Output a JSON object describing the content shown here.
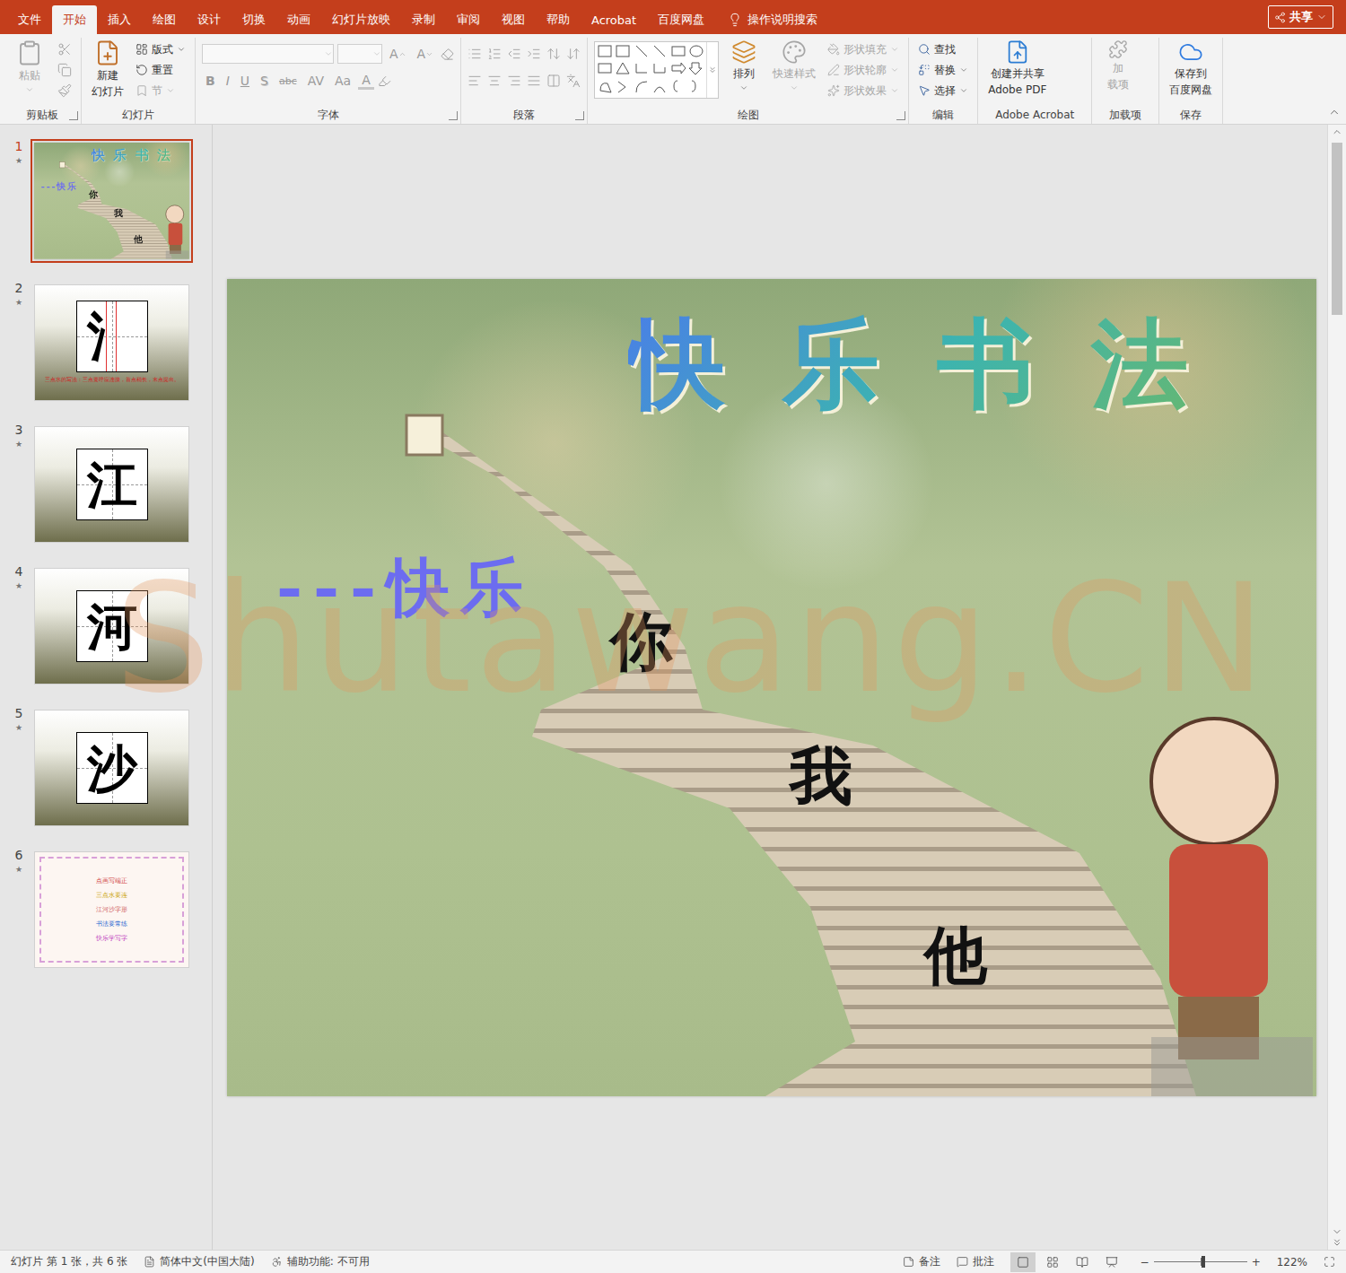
{
  "title_bar": {
    "tabs": [
      {
        "label": "文件",
        "selected": false
      },
      {
        "label": "开始",
        "selected": true
      },
      {
        "label": "插入",
        "selected": false
      },
      {
        "label": "绘图",
        "selected": false
      },
      {
        "label": "设计",
        "selected": false
      },
      {
        "label": "切换",
        "selected": false
      },
      {
        "label": "动画",
        "selected": false
      },
      {
        "label": "幻灯片放映",
        "selected": false
      },
      {
        "label": "录制",
        "selected": false
      },
      {
        "label": "审阅",
        "selected": false
      },
      {
        "label": "视图",
        "selected": false
      },
      {
        "label": "帮助",
        "selected": false
      },
      {
        "label": "Acrobat",
        "selected": false
      },
      {
        "label": "百度网盘",
        "selected": false
      }
    ],
    "search": "操作说明搜索",
    "share": "共享"
  },
  "ribbon": {
    "clipboard": {
      "label": "剪贴板",
      "launcher": true,
      "paste": {
        "label": "粘贴",
        "disabled": true
      },
      "tools": [
        {
          "disabled": true
        },
        {
          "disabled": true
        },
        {
          "disabled": true
        }
      ]
    },
    "slides": {
      "label": "幻灯片",
      "launcher": false,
      "new_slide": {
        "lines": [
          "新建",
          "幻灯片"
        ],
        "disabled": false
      },
      "items": [
        {
          "label": "版式",
          "disabled": false,
          "dropdown": true
        },
        {
          "label": "重置",
          "disabled": false,
          "dropdown": false
        },
        {
          "label": "节",
          "disabled": true,
          "dropdown": true
        }
      ]
    },
    "font": {
      "label": "字体",
      "launcher": true,
      "disabled": true,
      "size_buttons": [
        {
          "label": "A",
          "kind": "grow"
        },
        {
          "label": "A",
          "kind": "shrink"
        }
      ],
      "buttons": [
        {
          "label": "B",
          "kind": "bold"
        },
        {
          "label": "I",
          "kind": "italic"
        },
        {
          "label": "U",
          "kind": "underline"
        },
        {
          "label": "S",
          "kind": "shadow"
        },
        {
          "label": "abc",
          "kind": "strike"
        },
        {
          "label": "AV",
          "kind": "spacing"
        },
        {
          "label": "Aa",
          "kind": "case"
        },
        {
          "label": "A",
          "kind": "color"
        }
      ]
    },
    "paragraph": {
      "label": "段落",
      "launcher": true,
      "disabled": true
    },
    "drawing": {
      "label": "绘图",
      "launcher": true,
      "arrange": {
        "label": "排列",
        "disabled": false
      },
      "quick_styles": {
        "label": "快速样式",
        "disabled": true
      },
      "shape_options": [
        {
          "label": "形状填充",
          "disabled": true
        },
        {
          "label": "形状轮廓",
          "disabled": true
        },
        {
          "label": "形状效果",
          "disabled": true
        }
      ]
    },
    "editing": {
      "label": "编辑",
      "launcher": false,
      "items": [
        {
          "label": "查找",
          "disabled": false,
          "dropdown": false
        },
        {
          "label": "替换",
          "disabled": false,
          "dropdown": true
        },
        {
          "label": "选择",
          "disabled": false,
          "dropdown": true
        }
      ]
    },
    "acrobat": {
      "label": "Adobe Acrobat",
      "launcher": false,
      "button": {
        "lines": [
          "创建并共享",
          "Adobe PDF"
        ],
        "disabled": false
      }
    },
    "addins": {
      "label": "加载项",
      "launcher": false,
      "button": {
        "lines": [
          "加",
          "载项"
        ],
        "disabled": true
      }
    },
    "save": {
      "label": "保存",
      "launcher": false,
      "button": {
        "lines": [
          "保存到",
          "百度网盘"
        ],
        "disabled": false
      }
    }
  },
  "thumbnails": [
    {
      "number": "1",
      "mark": "★",
      "selected": true,
      "kind": "title"
    },
    {
      "number": "2",
      "mark": "★",
      "selected": false,
      "kind": "char",
      "char": "氵",
      "guides": true,
      "caption": "三点水的写法：三点要呼应连接，首点稍长，末点提出。"
    },
    {
      "number": "3",
      "mark": "★",
      "selected": false,
      "kind": "char",
      "char": "江",
      "guides": false
    },
    {
      "number": "4",
      "mark": "★",
      "selected": false,
      "kind": "char",
      "char": "河",
      "guides": false
    },
    {
      "number": "5",
      "mark": "★",
      "selected": false,
      "kind": "char",
      "char": "沙",
      "guides": false
    },
    {
      "number": "6",
      "mark": "★",
      "selected": false,
      "kind": "poem",
      "lines": [
        {
          "text": "点画写端正",
          "color": "#d04040"
        },
        {
          "text": "三点水要连",
          "color": "#c8a000"
        },
        {
          "text": "江河沙字形",
          "color": "#d06060"
        },
        {
          "text": "书法要常练",
          "color": "#2060d0"
        },
        {
          "text": "快乐学写字",
          "color": "#c040c0"
        }
      ]
    }
  ],
  "slide": {
    "title": "快乐书法",
    "subtitle": "---快乐",
    "words": [
      "你",
      "我",
      "他"
    ]
  },
  "watermark": "Shutawang.CN",
  "status_bar": {
    "left": [
      "幻灯片 第 1 张，共 6 张",
      "简体中文(中国大陆)",
      "辅助功能: 不可用"
    ],
    "notes": "备注",
    "comments": "批注",
    "views": [
      {
        "selected": true
      },
      {
        "selected": false
      },
      {
        "selected": false
      },
      {
        "selected": false
      }
    ],
    "zoom": {
      "minus": "−",
      "plus": "+",
      "level": 0.53,
      "reading": "122%"
    }
  }
}
